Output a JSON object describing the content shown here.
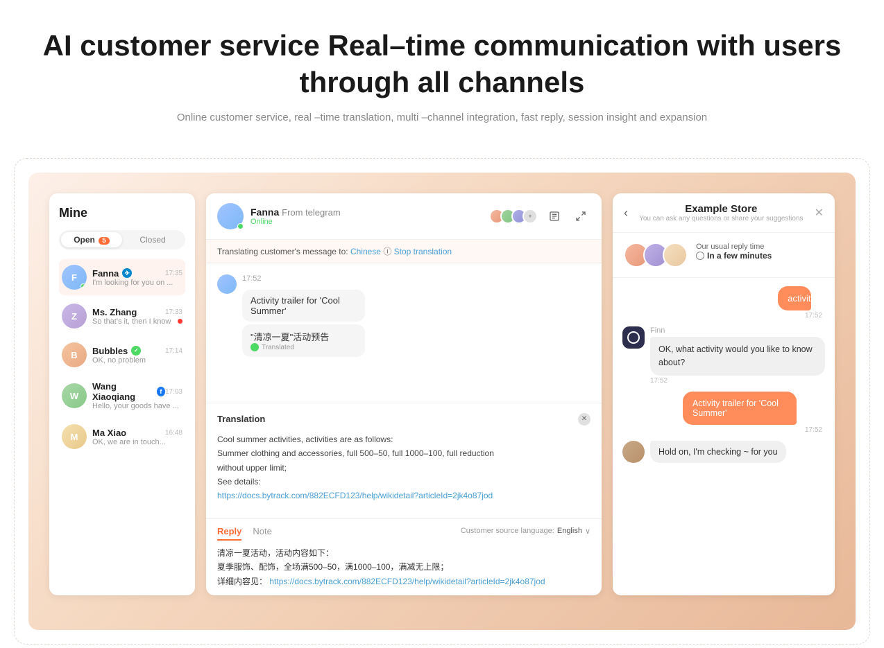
{
  "header": {
    "title": "AI customer service Real–time communication with users through all channels",
    "subtitle": "Online customer service, real –time translation, multi –channel integration, fast reply, session insight and expansion"
  },
  "left_panel": {
    "title": "Mine",
    "tabs": [
      {
        "label": "Open",
        "active": true,
        "badge": "5"
      },
      {
        "label": "Closed",
        "active": false
      }
    ],
    "chats": [
      {
        "name": "Fanna",
        "channel": "telegram",
        "time": "17:35",
        "preview": "I'm looking for you on ...",
        "active": true,
        "online": true
      },
      {
        "name": "Ms. Zhang",
        "channel": "none",
        "time": "17:33",
        "preview": "So that's it, then I know",
        "active": false,
        "unread": true
      },
      {
        "name": "Bubbles",
        "channel": "verified",
        "time": "17:14",
        "preview": "OK, no problem",
        "active": false
      },
      {
        "name": "Wang Xiaoqiang",
        "channel": "facebook",
        "time": "17:03",
        "preview": "Hello, your goods have ...",
        "active": false
      },
      {
        "name": "Ma Xiao",
        "channel": "none",
        "time": "16:48",
        "preview": "OK, we are in touch...",
        "active": false
      }
    ]
  },
  "center_panel": {
    "header": {
      "name": "Fanna",
      "source": "From telegram",
      "status": "Online"
    },
    "translation_bar": {
      "prefix": "Translating customer's message to:",
      "language": "Chinese",
      "stop_label": "Stop translation"
    },
    "messages": [
      {
        "time": "17:52",
        "text": "Activity trailer for 'Cool Summer'",
        "type": "received"
      },
      {
        "text": "\"清凉一夏\"活动预告",
        "translated_label": "Translated",
        "type": "received_translated"
      }
    ],
    "translation_section": {
      "label": "Translation",
      "content_line1": "Cool summer activities, activities are as follows:",
      "content_line2": "Summer clothing and accessories, full 500–50, full 1000–100, full reduction",
      "content_line3": "without upper limit;",
      "content_line4": "See details:",
      "link": "https://docs.bytrack.com/882ECFD123/help/wikidetail?articleId=2jk4o87jod"
    },
    "reply_section": {
      "tabs": [
        "Reply",
        "Note"
      ],
      "source_label": "Customer source language:",
      "source_lang": "English",
      "reply_line1": "清凉一夏活动，活动内容如下：",
      "reply_line2": "夏季服饰、配饰，全场满500–50，满1000–100，满减无上限；",
      "reply_line3": "详细内容见：",
      "reply_link": "https://docs.bytrack.com/882ECFD123/help/wikidetail?articleId=2jk4o87jod"
    }
  },
  "right_panel": {
    "store_name": "Example Store",
    "store_sub": "You can ask any questions or share your suggestions",
    "reply_time_label": "Our usual reply time",
    "reply_time": "In a few minutes",
    "messages": [
      {
        "type": "user",
        "text": "activity",
        "time": "17:52"
      },
      {
        "type": "agent",
        "agent_name": "Finn",
        "text": "OK, what activity would you like to know about?",
        "time": "17:52"
      },
      {
        "type": "user",
        "text": "Activity trailer for 'Cool Summer'",
        "time": "17:52"
      },
      {
        "type": "agent_human",
        "text": "Hold on, I'm checking ~ for you"
      }
    ]
  }
}
